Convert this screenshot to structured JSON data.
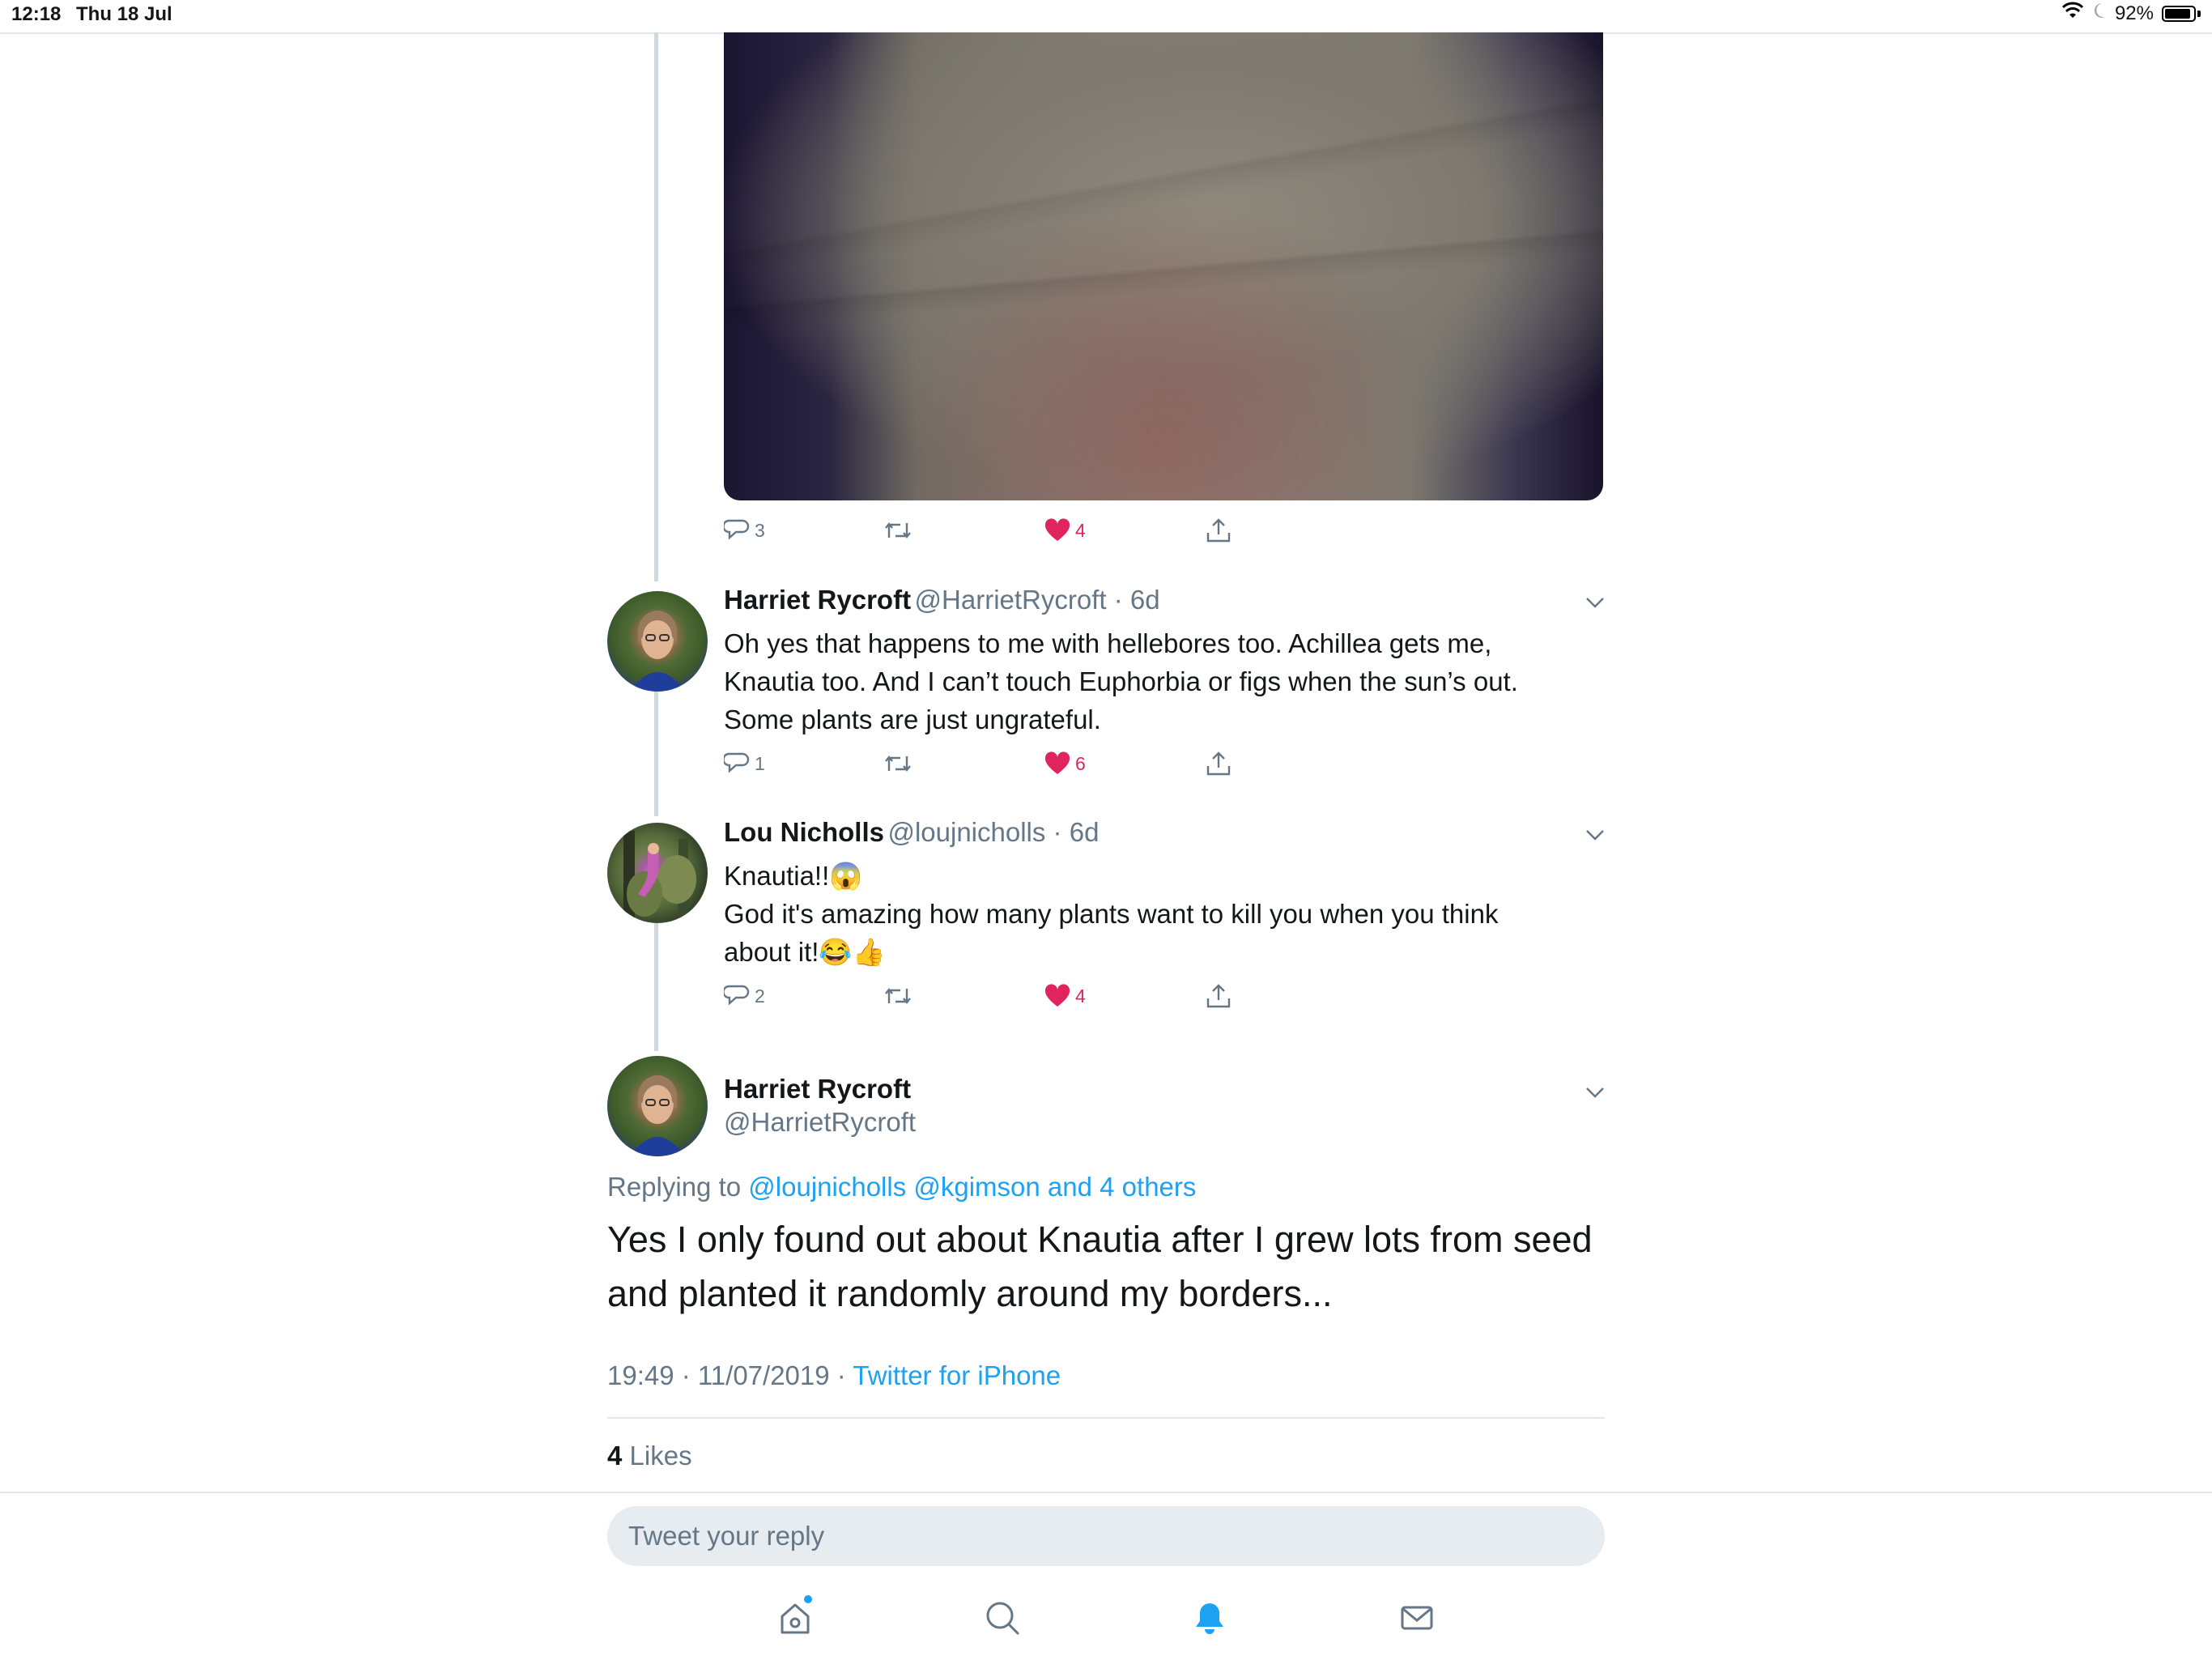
{
  "status_bar": {
    "time": "12:18",
    "date": "Thu 18 Jul",
    "battery": "92%",
    "battery_level": 0.92
  },
  "media_tweet_actions": {
    "replies": "3",
    "likes": "4"
  },
  "tweets": [
    {
      "name": "Harriet Rycroft",
      "handle": "@HarrietRycroft",
      "time": "6d",
      "text_lines": [
        "Oh yes that happens to me with hellebores too. Achillea gets me,",
        "Knautia too. And I can’t touch Euphorbia or figs when the sun’s out.",
        "Some plants are just ungrateful."
      ],
      "replies": "1",
      "likes": "6"
    },
    {
      "name": "Lou Nicholls",
      "handle": "@loujnicholls",
      "time": "6d",
      "text_lines": [
        "Knautia!!😱",
        "God it's amazing how many plants want to kill you when you think",
        "about it!😂👍"
      ],
      "replies": "2",
      "likes": "4"
    }
  ],
  "focused_tweet": {
    "name": "Harriet Rycroft",
    "handle": "@HarrietRycroft",
    "replying_prefix": "Replying to",
    "replying_to": "@loujnicholls @kgimson and 4 others",
    "text_lines": [
      "Yes I only found out about Knautia after I grew lots from seed",
      "and planted it randomly around my borders..."
    ],
    "timestamp": "19:49 · 11/07/2019 ·",
    "source": "Twitter for iPhone",
    "likes_count": "4",
    "likes_label": "Likes"
  },
  "reply_box": {
    "placeholder": "Tweet your reply"
  },
  "tab_bar": {
    "icons": [
      "home-icon",
      "search-icon",
      "notifications-icon",
      "messages-icon"
    ],
    "active": "notifications-icon"
  },
  "colors": {
    "accent": "#1da1f2",
    "like": "#e0245e",
    "secondary_text": "#657786"
  }
}
